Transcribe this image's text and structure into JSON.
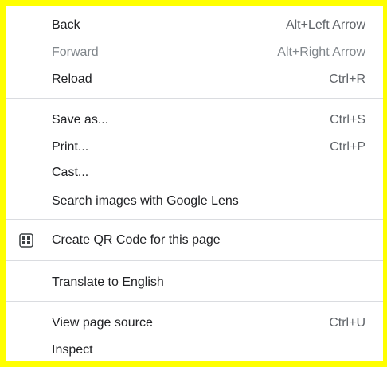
{
  "menu": {
    "back": {
      "label": "Back",
      "shortcut": "Alt+Left Arrow"
    },
    "forward": {
      "label": "Forward",
      "shortcut": "Alt+Right Arrow"
    },
    "reload": {
      "label": "Reload",
      "shortcut": "Ctrl+R"
    },
    "save_as": {
      "label": "Save as...",
      "shortcut": "Ctrl+S"
    },
    "print": {
      "label": "Print...",
      "shortcut": "Ctrl+P"
    },
    "cast": {
      "label": "Cast..."
    },
    "search_lens": {
      "label": "Search images with Google Lens"
    },
    "qr_code": {
      "label": "Create QR Code for this page",
      "icon": "qr-code-icon"
    },
    "translate": {
      "label": "Translate to English"
    },
    "view_source": {
      "label": "View page source",
      "shortcut": "Ctrl+U"
    },
    "inspect": {
      "label": "Inspect"
    }
  },
  "colors": {
    "frame": "#ffff00",
    "background": "#ffffff",
    "text": "#202124",
    "disabled_text": "#80868b",
    "separator": "#dadce0"
  }
}
